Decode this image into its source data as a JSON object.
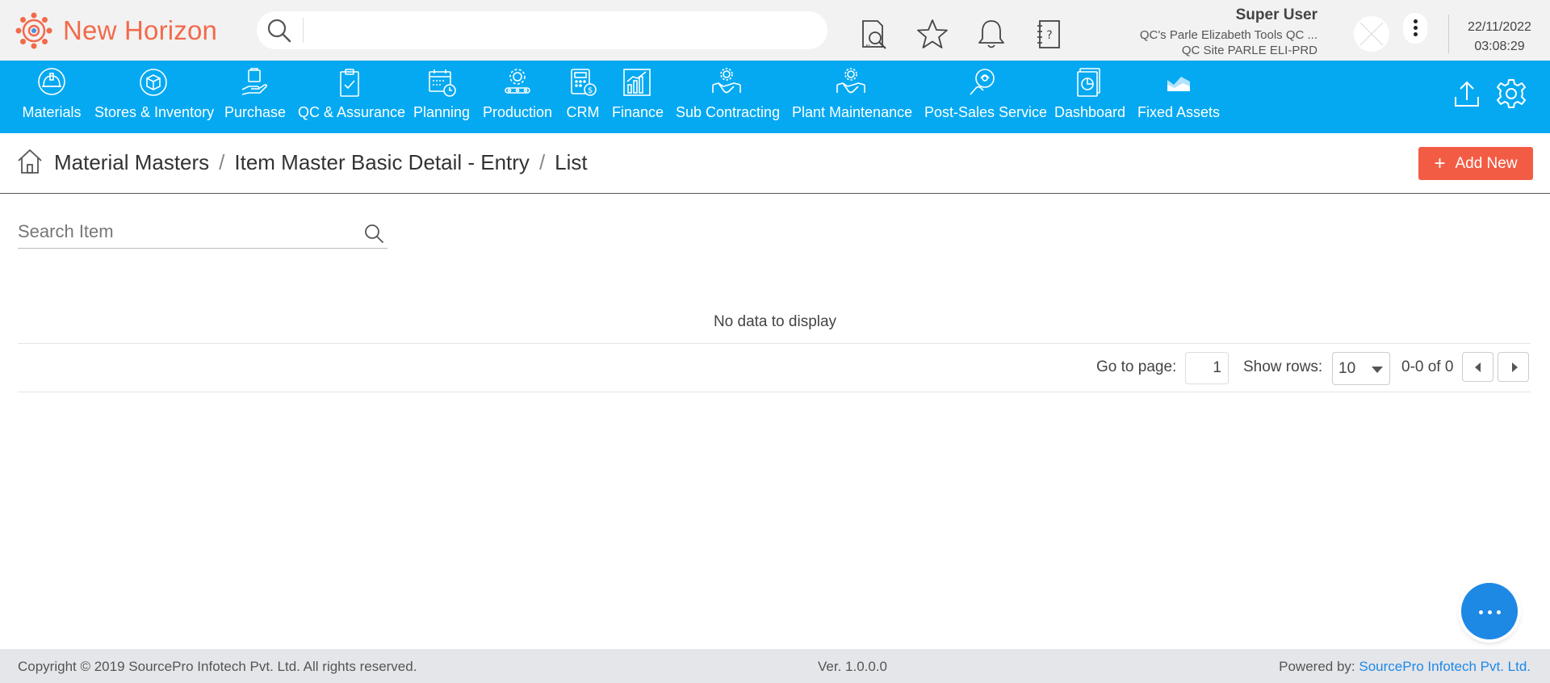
{
  "app": {
    "name": "New Horizon",
    "brand_color": "#f26a4b"
  },
  "topbar": {
    "search_placeholder": "",
    "icons": [
      "document-search-icon",
      "star-icon",
      "bell-icon",
      "help-book-icon"
    ],
    "user": {
      "name": "Super User",
      "org": "QC's Parle Elizabeth Tools QC ...",
      "site": "QC Site PARLE ELI-PRD"
    },
    "date": "22/11/2022",
    "time": "03:08:29"
  },
  "nav": {
    "background": "#04a9f1",
    "items": [
      {
        "label": "Materials",
        "icon": "helmet-icon"
      },
      {
        "label": "Stores & Inventory",
        "icon": "box-cycle-icon"
      },
      {
        "label": "Purchase",
        "icon": "hand-bag-icon"
      },
      {
        "label": "QC & Assurance",
        "icon": "clipboard-check-icon"
      },
      {
        "label": "Planning",
        "icon": "calendar-clock-icon"
      },
      {
        "label": "Production",
        "icon": "gear-conveyor-icon"
      },
      {
        "label": "CRM",
        "icon": "calculator-dollar-icon"
      },
      {
        "label": "Finance",
        "icon": "bar-chart-icon"
      },
      {
        "label": "Sub Contracting",
        "icon": "handshake-gear-icon"
      },
      {
        "label": "Plant Maintenance",
        "icon": "handshake-gear-icon"
      },
      {
        "label": "Post-Sales Service",
        "icon": "support-hand-icon"
      },
      {
        "label": "Dashboard",
        "icon": "document-pie-icon"
      },
      {
        "label": "Fixed Assets",
        "icon": "area-chart-icon"
      }
    ],
    "right_icons": [
      "upload-icon",
      "settings-icon"
    ]
  },
  "breadcrumb": {
    "items": [
      "Material Masters",
      "Item Master Basic Detail - Entry",
      "List"
    ],
    "separator": "/"
  },
  "actions": {
    "add_new": "Add New",
    "add_new_color": "#f35c44"
  },
  "search_item": {
    "placeholder": "Search Item"
  },
  "grid": {
    "empty_text": "No data to display",
    "goto_label": "Go to page:",
    "page": "1",
    "rows_label": "Show rows:",
    "rows": "10",
    "range": "0-0 of 0"
  },
  "footer": {
    "copyright": "Copyright © 2019 SourcePro Infotech Pvt. Ltd. All rights reserved.",
    "version": "Ver. 1.0.0.0",
    "powered_label": "Powered by:",
    "powered_link": "SourcePro Infotech Pvt. Ltd.",
    "link_color": "#1e88e5"
  }
}
